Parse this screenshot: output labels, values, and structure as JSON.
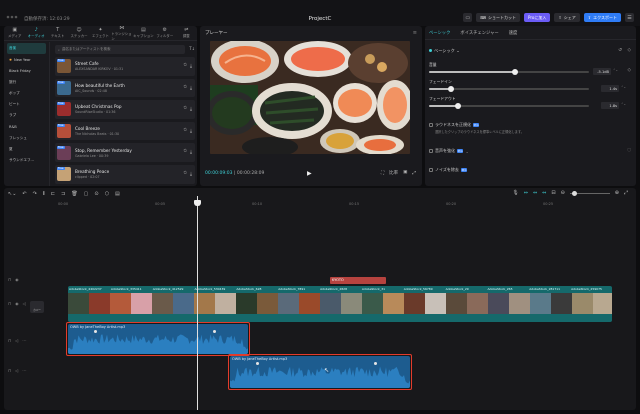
{
  "window": {
    "autosave": "自動保存済: 12:03:29",
    "title": "ProjectC",
    "buttons": {
      "shortcut": "ショートカット",
      "pro": "Proに加入",
      "share": "シェア",
      "export": "エクスポート"
    }
  },
  "left": {
    "tools": [
      {
        "label": "メディア",
        "icon": "▣"
      },
      {
        "label": "オーディオ",
        "icon": "♪"
      },
      {
        "label": "テキスト",
        "icon": "T"
      },
      {
        "label": "ステッカー",
        "icon": "☺"
      },
      {
        "label": "エフェクト",
        "icon": "✦"
      },
      {
        "label": "トランジション",
        "icon": "⋈"
      },
      {
        "label": "キャプション",
        "icon": "▤"
      },
      {
        "label": "フィルター",
        "icon": "⚙"
      },
      {
        "label": "調整",
        "icon": "⇌"
      }
    ],
    "active_tool": 1,
    "categories": [
      "音楽",
      "New Year",
      "Black Friday",
      "旅行",
      "ポップ",
      "ビート",
      "ラブ",
      "R&B",
      "フレッシュ",
      "夏",
      "サウンドエフ..."
    ],
    "active_category": 0,
    "search_placeholder": "曲名またはアーティストを検索",
    "sort_label": "T↓",
    "free_badge": "Free",
    "tracks": [
      {
        "name": "Street Cafe",
        "sub": "ALEXSANDAR KIRKOV · 01:31",
        "color": "#7a5636"
      },
      {
        "name": "How beautiful the Earth",
        "sub": "AIC_Sounds · 02:48",
        "color": "#3b6a8f"
      },
      {
        "name": "Upbeat Christmas Pop",
        "sub": "SoundRiseStudio · 01:36",
        "color": "#9c2d2d"
      },
      {
        "name": "Cool Breeze",
        "sub": "The Nicholas Beats · 01:30",
        "color": "#b64f3a"
      },
      {
        "name": "Stop, Remember Yesterday",
        "sub": "Gabriela Lee · 00:39",
        "color": "#6b3e57"
      },
      {
        "name": "Breathing Peace",
        "sub": "clipped · 02:07",
        "color": "#c5a276"
      }
    ]
  },
  "player": {
    "title": "プレーヤー",
    "current": "00:00:09:03",
    "total": "00:00:28:09",
    "right_controls": [
      "⛶",
      "比率",
      "▣",
      "⤢"
    ]
  },
  "right": {
    "tabs": [
      "ベーシック",
      "ボイスチェンジャー",
      "速度"
    ],
    "active_tab": 0,
    "basic_label": "ベーシック",
    "volume": {
      "label": "音量",
      "value": "-5.1dB",
      "level": 0.54
    },
    "fade_in": {
      "label": "フェードイン",
      "value": "1.4s",
      "level": 0.14
    },
    "fade_out": {
      "label": "フェードアウト",
      "value": "1.8s",
      "level": 0.18
    },
    "loudness": {
      "label": "ラウドネスを正規化",
      "desc": "選択したクリップのラウドネスを標準レベルに正規化します。"
    },
    "enhance": {
      "label": "音声を強化"
    },
    "noise": {
      "label": "ノイズを除去"
    },
    "pro_badge": "Pro"
  },
  "timeline": {
    "ruler": [
      "00:00",
      "00:05",
      "00:10",
      "00:15",
      "00:20",
      "00:25"
    ],
    "cover_label": "カバー",
    "text_clip": "KYOTO",
    "video_labels": [
      "AdobeStock_4402237",
      "AdobeStock_335411",
      "AdobeStock_412529",
      "AdobeStock_530439",
      "AdobeStock_628",
      "AdobeStock_7891",
      "AdobeStock_2828",
      "AdobeStock_31",
      "AdobeStock_56789",
      "AdobeStock_29",
      "AdobeStock_265",
      "AdobeStock_281711",
      "AdobeStock_259075"
    ],
    "audio1": "OWB by JaneTheBoy Artist.mp3",
    "audio2": "OWB by JaneTheBoy Artist.mp3"
  }
}
